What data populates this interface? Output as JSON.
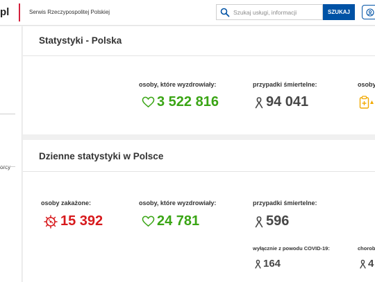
{
  "header": {
    "logo_tail": "pl",
    "service_name": "Serwis Rzeczypospolitej Polskiej",
    "search_placeholder": "Szukaj usługi, informacji",
    "search_button": "SZUKAJ"
  },
  "sidebar": {
    "partial_item": "orcy"
  },
  "overall": {
    "title": "Statystyki - Polska",
    "recovered_label": "osoby, które wyzdrowiały:",
    "recovered_value": "3 522 816",
    "deaths_label": "przypadki śmiertelne:",
    "deaths_value": "94 041",
    "partial_label": "osoby"
  },
  "daily": {
    "title": "Dzienne statystyki w Polsce",
    "infected_label": "osoby zakażone:",
    "infected_value": "15 392",
    "recovered_label": "osoby, które wyzdrowiały:",
    "recovered_value": "24 781",
    "deaths_label": "przypadki śmiertelne:",
    "deaths_value": "596",
    "covid_only_label": "wyłącznie z powodu COVID-19:",
    "covid_only_value": "164",
    "comorbid_label": "chorob",
    "comorbid_value": "4"
  },
  "colors": {
    "brand_blue": "#0052a5",
    "recovered_green": "#3aa515",
    "infected_red": "#d7191c",
    "deaths_gray": "#474747",
    "vaccine_orange": "#f2a900"
  }
}
